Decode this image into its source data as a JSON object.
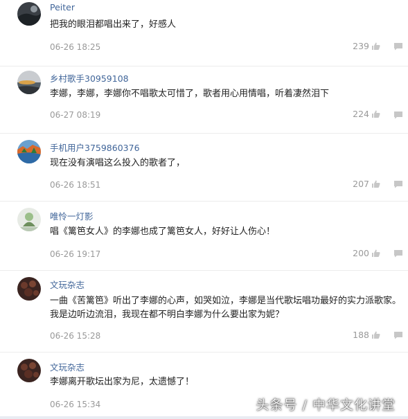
{
  "comments": [
    {
      "username": "Peiter",
      "text": "把我的眼泪都唱出来了，好感人",
      "time": "06-26 18:25",
      "likes": "239"
    },
    {
      "username": "乡村歌手30959108",
      "text": "李娜，李娜，李娜你不唱歌太可惜了，歌者用心用情唱，听着凄然泪下",
      "time": "06-27 08:19",
      "likes": "224"
    },
    {
      "username": "手机用户3759860376",
      "text": "现在没有演唱这么投入的歌者了，",
      "time": "06-26 18:51",
      "likes": "207"
    },
    {
      "username": "唯怜一灯影",
      "text": "唱《篱笆女人》的李娜也成了篱笆女人，好好让人伤心！",
      "time": "06-26 19:17",
      "likes": "200"
    },
    {
      "username": "文玩杂志",
      "text": "一曲《苦篱笆》听出了李娜的心声，如哭如泣，李娜是当代歌坛唱功最好的实力派歌家。我是边听边流泪，我现在都不明白李娜为什么要出家为妮？",
      "time": "06-26 15:28",
      "likes": "188"
    },
    {
      "username": "文玩杂志",
      "text": "李娜离开歌坛出家为尼，太遗憾了！",
      "time": "06-26 15:34",
      "likes": ""
    }
  ],
  "watermark": "头条号 / 中华文化讲堂",
  "icons": {
    "like": "thumbs-up-icon",
    "reply": "reply-icon"
  }
}
